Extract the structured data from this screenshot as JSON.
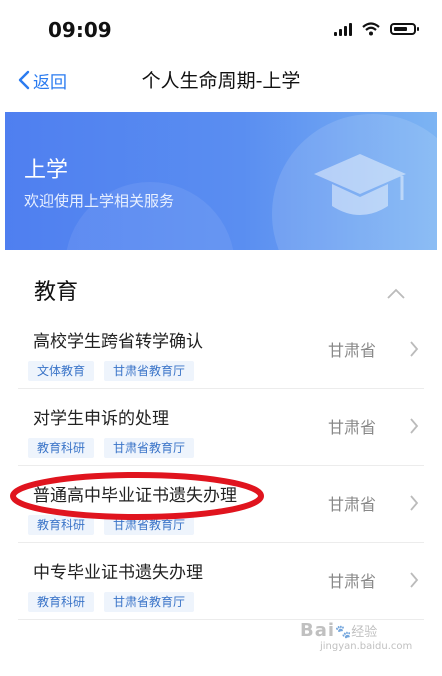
{
  "status": {
    "time": "09:09"
  },
  "nav": {
    "back_label": "返回",
    "title": "个人生命周期-上学"
  },
  "banner": {
    "title": "上学",
    "subtitle": "欢迎使用上学相关服务"
  },
  "section": {
    "title": "教育",
    "items": [
      {
        "title": "高校学生跨省转学确认",
        "tags": [
          "文体教育",
          "甘肃省教育厅"
        ],
        "region": "甘肃省"
      },
      {
        "title": "对学生申诉的处理",
        "tags": [
          "教育科研",
          "甘肃省教育厅"
        ],
        "region": "甘肃省"
      },
      {
        "title": "普通高中毕业证书遗失办理",
        "tags": [
          "教育科研",
          "甘肃省教育厅"
        ],
        "region": "甘肃省"
      },
      {
        "title": "中专毕业证书遗失办理",
        "tags": [
          "教育科研",
          "甘肃省教育厅"
        ],
        "region": "甘肃省"
      }
    ]
  },
  "watermark": {
    "brand": "Bai",
    "suffix": "经验",
    "url": "jingyan.baidu.com"
  },
  "colors": {
    "accent": "#2a7bf0",
    "banner_start": "#4f7ff0",
    "banner_end": "#7cb4f3",
    "highlight": "#e0141e"
  }
}
